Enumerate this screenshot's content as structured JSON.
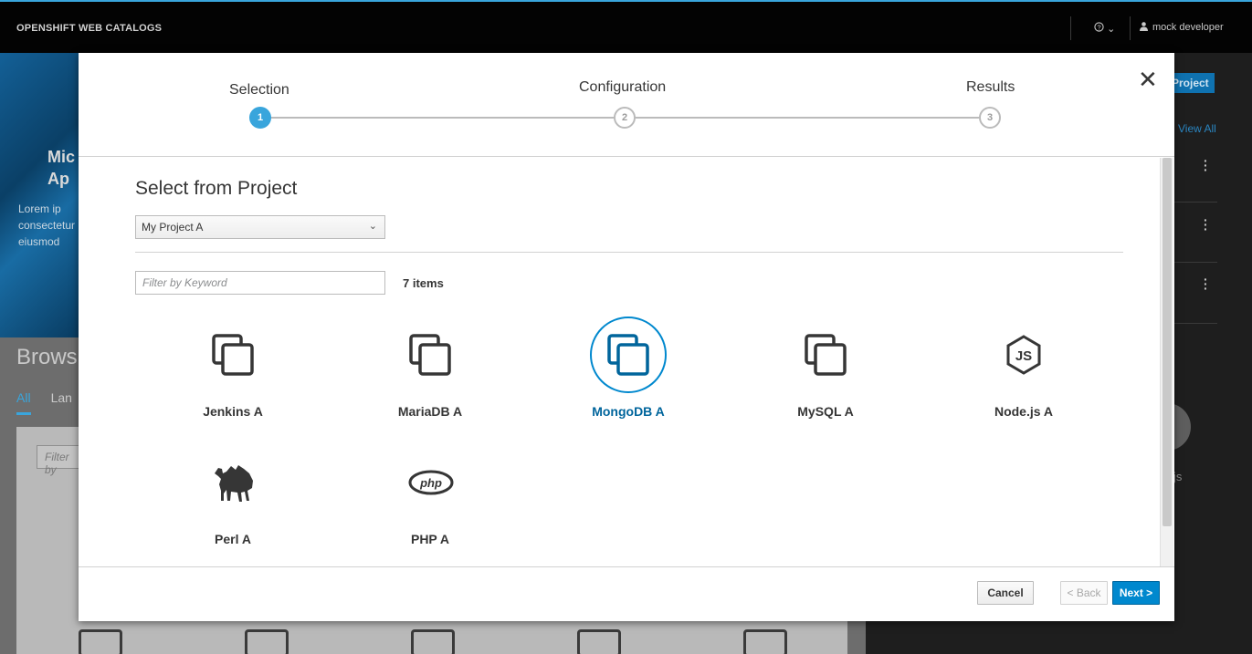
{
  "topbar": {
    "brand": "OPENSHIFT WEB CATALOGS",
    "help_label": "?",
    "user_label": "mock developer"
  },
  "background": {
    "hero_title_line1": "Mic",
    "hero_title_line2": "Ap",
    "hero_text_line1": "Lorem ip",
    "hero_text_line2": "consectetur",
    "hero_text_line3": "eiusmod",
    "browse_label": "Brows",
    "tab_all": "All",
    "tab_lang": "Lan",
    "filter_placeholder": "Filter by",
    "project_button": "Project",
    "view_all": "View All",
    "js_label": "js"
  },
  "wizard": {
    "steps": [
      {
        "number": "1",
        "label": "Selection",
        "active": true
      },
      {
        "number": "2",
        "label": "Configuration",
        "active": false
      },
      {
        "number": "3",
        "label": "Results",
        "active": false
      }
    ],
    "close_label": "✕",
    "section_title": "Select from Project",
    "project_select_value": "My Project A",
    "filter_placeholder": "Filter by Keyword",
    "items_count": "7 items",
    "items": [
      {
        "label": "Jenkins A",
        "icon": "copy-icon",
        "selected": false
      },
      {
        "label": "MariaDB A",
        "icon": "copy-icon",
        "selected": false
      },
      {
        "label": "MongoDB A",
        "icon": "copy-icon",
        "selected": true
      },
      {
        "label": "MySQL A",
        "icon": "copy-icon",
        "selected": false
      },
      {
        "label": "Node.js A",
        "icon": "nodejs-icon",
        "selected": false
      },
      {
        "label": "Perl A",
        "icon": "perl-camel-icon",
        "selected": false
      },
      {
        "label": "PHP A",
        "icon": "php-icon",
        "selected": false
      }
    ],
    "buttons": {
      "cancel": "Cancel",
      "back": "< Back",
      "next": "Next >"
    }
  },
  "colors": {
    "accent": "#39a5dc",
    "selected": "#0088ce",
    "primary_button": "#0088ce"
  }
}
